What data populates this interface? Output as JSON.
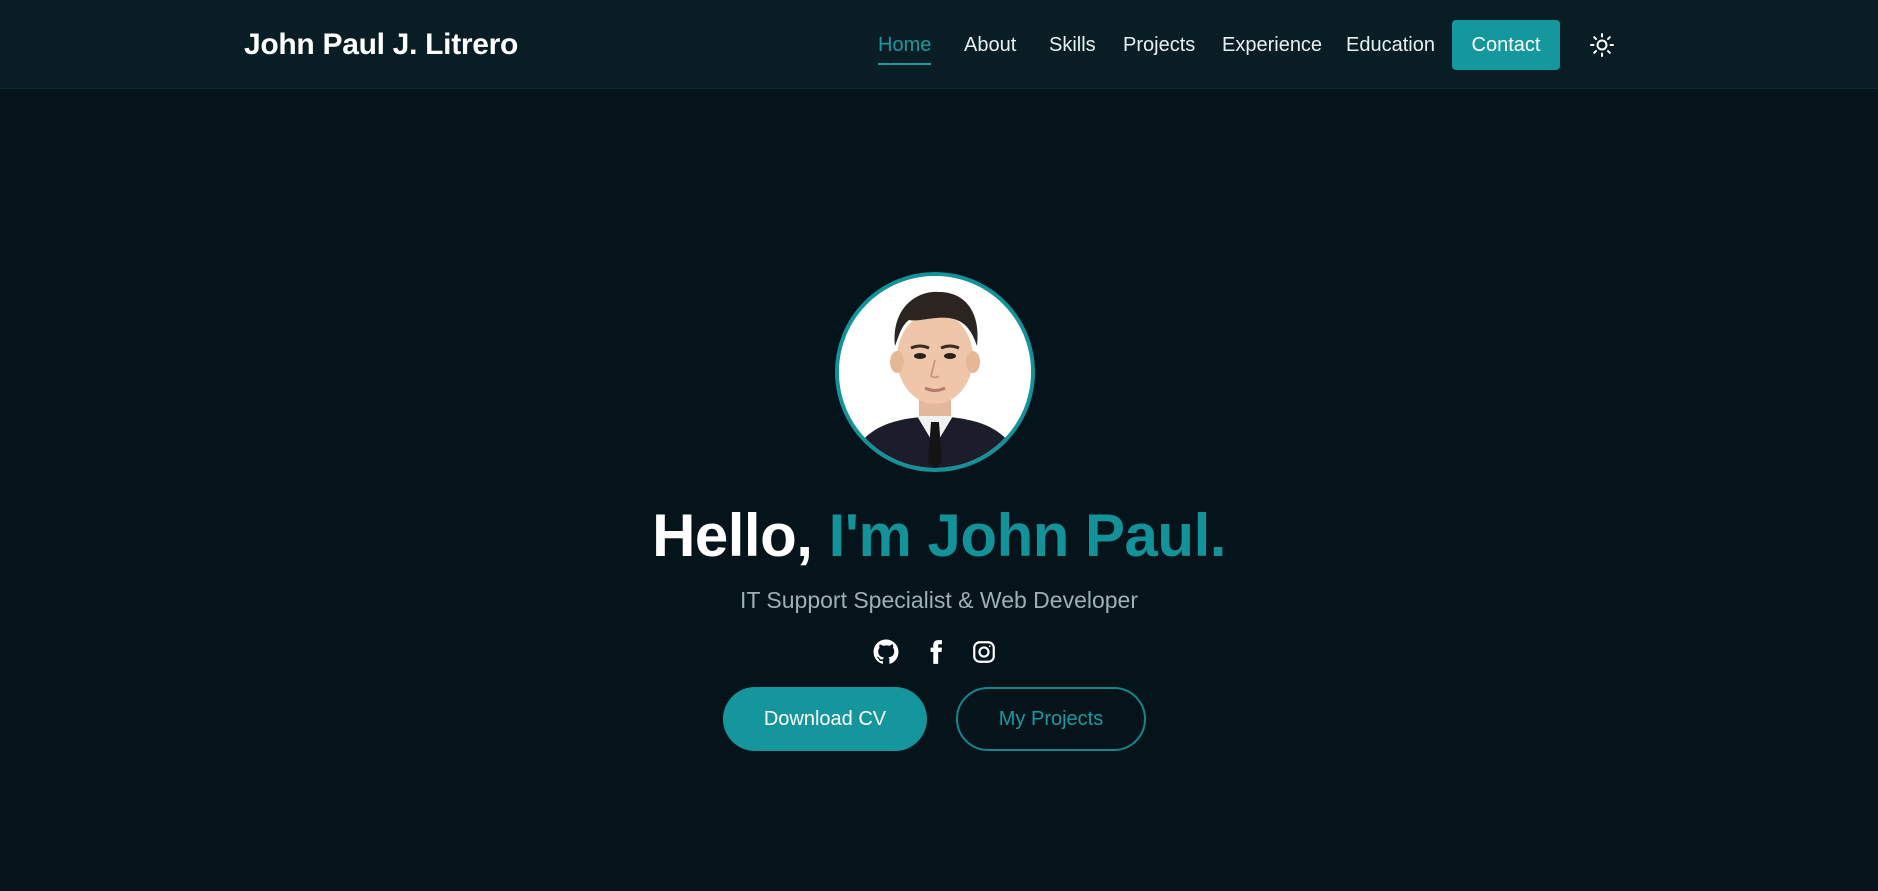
{
  "brand": "John Paul J. Litrero",
  "nav": {
    "items": [
      "Home",
      "About",
      "Skills",
      "Projects",
      "Experience",
      "Education"
    ],
    "active": "Home",
    "contact_label": "Contact",
    "theme_icon": "sun-icon"
  },
  "hero": {
    "greeting": "Hello, ",
    "name": "I'm John Paul.",
    "subtitle": "IT Support Specialist & Web Developer",
    "socials": [
      "github-icon",
      "facebook-icon",
      "instagram-icon"
    ],
    "primary_button": "Download CV",
    "secondary_button": "My Projects"
  },
  "colors": {
    "background": "#04141a",
    "navbar": "#081e24",
    "accent": "#13929a"
  }
}
